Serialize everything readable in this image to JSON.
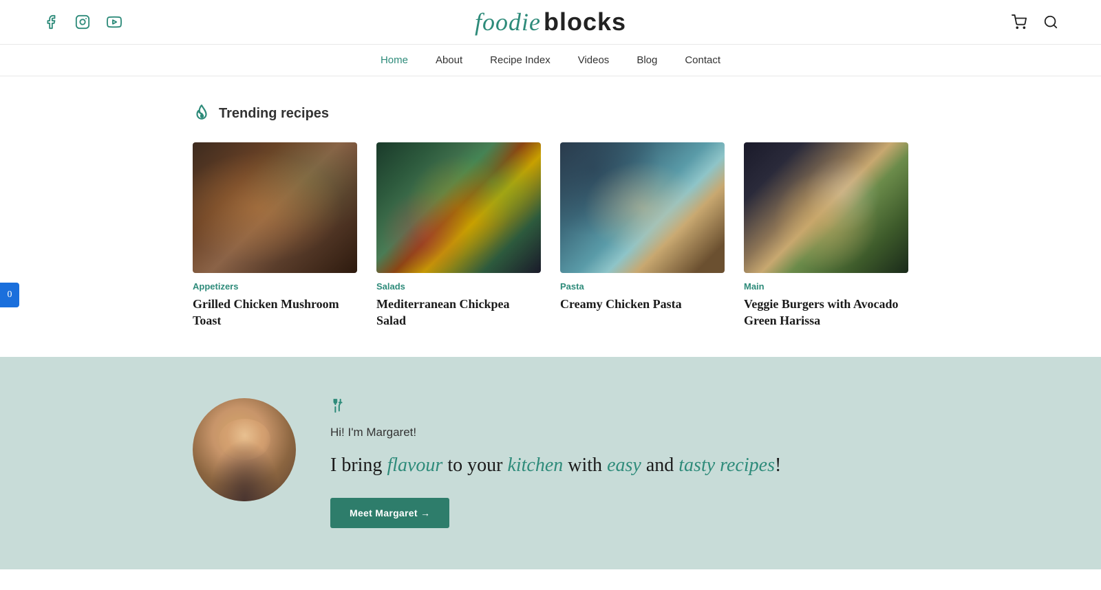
{
  "site": {
    "logo_italic": "foodie",
    "logo_bold": "blocks"
  },
  "social": {
    "facebook_label": "Facebook",
    "instagram_label": "Instagram",
    "youtube_label": "YouTube"
  },
  "header": {
    "cart_label": "Cart",
    "search_label": "Search"
  },
  "nav": {
    "items": [
      {
        "label": "Home",
        "active": true
      },
      {
        "label": "About",
        "active": false
      },
      {
        "label": "Recipe Index",
        "active": false
      },
      {
        "label": "Videos",
        "active": false
      },
      {
        "label": "Blog",
        "active": false
      },
      {
        "label": "Contact",
        "active": false
      }
    ]
  },
  "sidebar": {
    "widget_label": "0"
  },
  "trending": {
    "section_title": "Trending recipes",
    "recipes": [
      {
        "category": "Appetizers",
        "title": "Grilled Chicken Mushroom Toast",
        "img_class": "img-toast"
      },
      {
        "category": "Salads",
        "title": "Mediterranean Chickpea Salad",
        "img_class": "img-salad"
      },
      {
        "category": "Pasta",
        "title": "Creamy Chicken Pasta",
        "img_class": "img-pasta"
      },
      {
        "category": "Main",
        "title": "Veggie Burgers with Avocado Green Harissa",
        "img_class": "img-burger"
      }
    ]
  },
  "about": {
    "greeting": "Hi! I'm Margaret!",
    "tagline_plain1": "I bring ",
    "tagline_italic1": "flavour",
    "tagline_plain2": " to your ",
    "tagline_italic2": "kitchen",
    "tagline_plain3": " with ",
    "tagline_italic3": "easy",
    "tagline_plain4": " and ",
    "tagline_italic4": "tasty recipes",
    "tagline_end": "!",
    "button_label": "Meet Margaret →"
  }
}
